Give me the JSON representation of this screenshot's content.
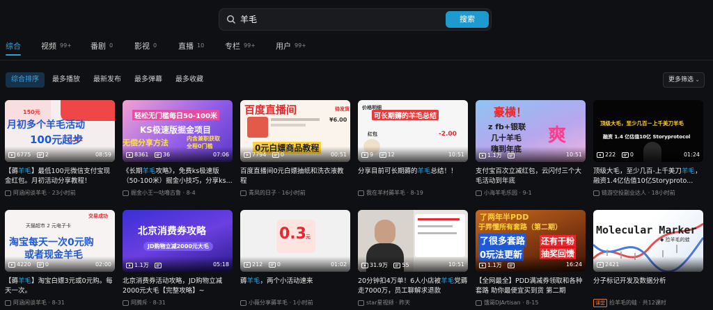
{
  "search": {
    "query": "羊毛",
    "button_label": "搜索"
  },
  "tabs": [
    {
      "label": "综合",
      "count": ""
    },
    {
      "label": "视频",
      "count": "99+"
    },
    {
      "label": "番剧",
      "count": "0"
    },
    {
      "label": "影视",
      "count": "0"
    },
    {
      "label": "直播",
      "count": "10"
    },
    {
      "label": "专栏",
      "count": "99+"
    },
    {
      "label": "用户",
      "count": "99+"
    }
  ],
  "filters": [
    "综合排序",
    "最多播放",
    "最新发布",
    "最多弹幕",
    "最多收藏"
  ],
  "more_filters": "更多筛选",
  "accent_color": "#2aa4e0",
  "cards": [
    {
      "plays": "6775",
      "danmaku": "2",
      "duration": "08:59",
      "title_pre": "【薅",
      "title_hl": "羊毛",
      "title_post": "】最低100元微信支付宝现金红包。月初活动分享教程！",
      "author": "阿涵闲谈羊毛 · 23小时前",
      "thumb_text": [
        "月初多个羊毛活动",
        "100元起步",
        "150元",
        "0.12"
      ]
    },
    {
      "plays": "8361",
      "danmaku": "36",
      "duration": "07:06",
      "title_pre": "《长期",
      "title_hl": "羊毛",
      "title_post": "攻略》，免费ks极速版（50-100米）掘金小技巧，分享ks...",
      "author": "掘金小王一咕噜古鲁 · 8-4",
      "thumb_text": [
        "轻松无门槛每日50-100米",
        "KS极速版掘金项目",
        "无偿分享方法",
        "内含兼职获取",
        "全程0门槛"
      ]
    },
    {
      "plays": "7794",
      "danmaku": "0",
      "duration": "00:51",
      "title_pre": "百度直播间0元白嫖抽纸和洗衣液教程",
      "title_hl": "",
      "title_post": "",
      "author": "青凤的日子 · 16小时前",
      "thumb_text": [
        "百度直播间",
        "0元白嫖商品教程",
        "¥6.00",
        "待发货"
      ]
    },
    {
      "plays": "9",
      "danmaku": "12",
      "duration": "10:51",
      "title_pre": "分享目前可长期薅的",
      "title_hl": "羊毛",
      "title_post": "总结！！",
      "author": "我在羊村薅羊毛 · 8-19",
      "thumb_text": [
        "可长期薅的羊毛总结",
        "价格明细",
        "-2.00",
        "红包"
      ]
    },
    {
      "plays": "1.1万",
      "danmaku": "",
      "duration": "10:51",
      "title_pre": "支付宝百次立减红包，云闪付三个大毛活动到年底",
      "title_hl": "",
      "title_post": "",
      "author": "小海羊毛乐园 · 9-1",
      "thumb_text": [
        "豪横！",
        "z fb+银联",
        "几十羊毛",
        "嗨到年底",
        "爽"
      ]
    },
    {
      "plays": "222",
      "danmaku": "0",
      "duration": "01:24",
      "title_pre": "顶级大毛，至少几百-上千美刀",
      "title_hl": "羊毛",
      "title_post": "，融资1.4亿估值10亿Storyproto...",
      "author": "链游空投副业达人 · 18小时前",
      "thumb_text": [
        "顶级大毛，至少几百－上千美刀羊毛",
        "融资 1.4 亿估值10亿 Storyprotocol"
      ]
    },
    {
      "plays": "4220",
      "danmaku": "0",
      "duration": "02:00",
      "title_pre": "【薅",
      "title_hl": "羊毛",
      "title_post": "】淘宝白嫖3元或0元购。每天一次。",
      "author": "阿涵闲谈羊毛 · 8-31",
      "thumb_text": [
        "淘宝每天一次0元购",
        "或者现金羊毛",
        "天猫超市 2 元电子卡",
        "交易成功"
      ]
    },
    {
      "plays": "1.1万",
      "danmaku": "",
      "duration": "05:18",
      "title_pre": "北京消费券活动攻略，JD购物立减2000元大毛【完整攻略】~",
      "title_hl": "",
      "title_post": "",
      "author": "阿腾斥 · 8-31",
      "thumb_text": [
        "北京消费券攻略",
        "JD购物立减2000元大毛"
      ]
    },
    {
      "plays": "212",
      "danmaku": "0",
      "duration": "01:02",
      "title_pre": "薅",
      "title_hl": "羊毛",
      "title_post": "，两个小活动速来",
      "author": "小薇分享薅羊毛 · 1小时前",
      "thumb_text": [
        "0.3",
        "元"
      ]
    },
    {
      "plays": "31.9万",
      "danmaku": "55",
      "duration": "10:51",
      "title_pre": "20分钟扣4万单！6人小店被",
      "title_hl": "羊毛",
      "title_post": "党薅走7000万，员工聊解求退款",
      "author": "star星视频 · 昨天",
      "thumb_text": []
    },
    {
      "plays": "1.1万",
      "danmaku": "",
      "duration": "16:24",
      "title_pre": "【全网最全】PDD满减券领取和各种套路 助你最便宜买到货 第二期",
      "title_hl": "",
      "title_post": "",
      "author": "饿哥DJArtisan · 8-15",
      "thumb_text": [
        "了两年半PDD",
        "于弄懂所有套路（第二期）",
        "了很多套路",
        "还有干粉",
        "抽奖回馈",
        "0玩法更新"
      ]
    },
    {
      "plays": "2421",
      "danmaku": "",
      "duration": "",
      "title_pre": "分子标记开发及数据分析",
      "title_hl": "",
      "title_post": "",
      "author": "捡羊毛的蛙 · 共12课时",
      "author_tag": "课堂",
      "thumb_text": [
        "Molecular Marker",
        "◆ 捡羊毛的蛙"
      ]
    }
  ]
}
